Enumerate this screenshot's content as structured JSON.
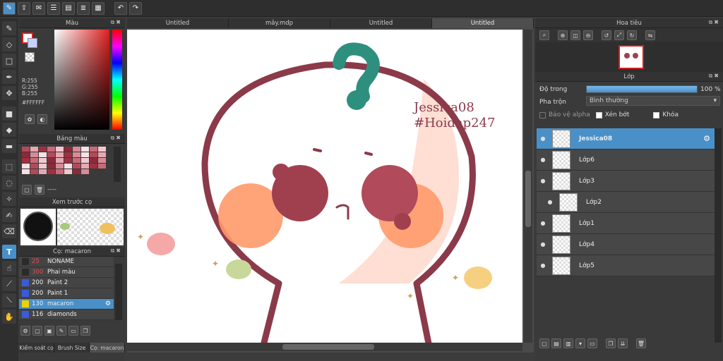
{
  "tabs": [
    "Untitled",
    "mây.mdp",
    "Untitled",
    "Untitled"
  ],
  "color_panel": {
    "title": "Màu",
    "r": "R:255",
    "g": "G:255",
    "b": "B:255",
    "hex": "#FFFFFF"
  },
  "palette_panel": {
    "title": "Bảng màu",
    "footer": "----"
  },
  "preview_panel": {
    "title": "Xem trước cọ"
  },
  "brush_panel": {
    "title": "Cọ: macaron",
    "items": [
      {
        "size": "25",
        "name": "NONAME",
        "color": "#2b2b2b",
        "size_color": "#e05050"
      },
      {
        "size": "300",
        "name": "Phai màu",
        "color": "#2b2b2b",
        "size_color": "#e05050"
      },
      {
        "size": "200",
        "name": "Paint 2",
        "color": "#3b5bdb",
        "size_color": "#eeeeee"
      },
      {
        "size": "200",
        "name": "Paint 1",
        "color": "#3b5bdb",
        "size_color": "#eeeeee"
      },
      {
        "size": "130",
        "name": "macaron",
        "color": "#f0d000",
        "size_color": "#eeeeee"
      },
      {
        "size": "116",
        "name": "diamonds",
        "color": "#3b5bdb",
        "size_color": "#eeeeee"
      }
    ],
    "bottom_tabs": [
      "Kiểm soát cọ",
      "Brush Size",
      "Cọ: macaron"
    ]
  },
  "navigator_panel": {
    "title": "Hoa tiêu"
  },
  "layers_panel": {
    "title": "Lớp",
    "opacity_label": "Độ trong",
    "opacity_value": "100 %",
    "opacity_fraction": 1.0,
    "blend_label": "Pha trộn",
    "blend_value": "Bình thường",
    "protect_alpha": "Bảo vệ alpha",
    "clipping": "Xén bớt",
    "lock": "Khóa",
    "layers": [
      "Jessica08",
      "Lớp6",
      "Lớp3",
      "Lớp2",
      "Lớp1",
      "Lớp4",
      "Lớp5"
    ]
  },
  "canvas": {
    "signature_line1": "Jessica08",
    "signature_line2": "#Hoidap247"
  },
  "colors": {
    "accent": "#4a90c8",
    "outline": "#8b3a4a",
    "blush": "#ff9a6a",
    "green": "#2f8f7f"
  }
}
